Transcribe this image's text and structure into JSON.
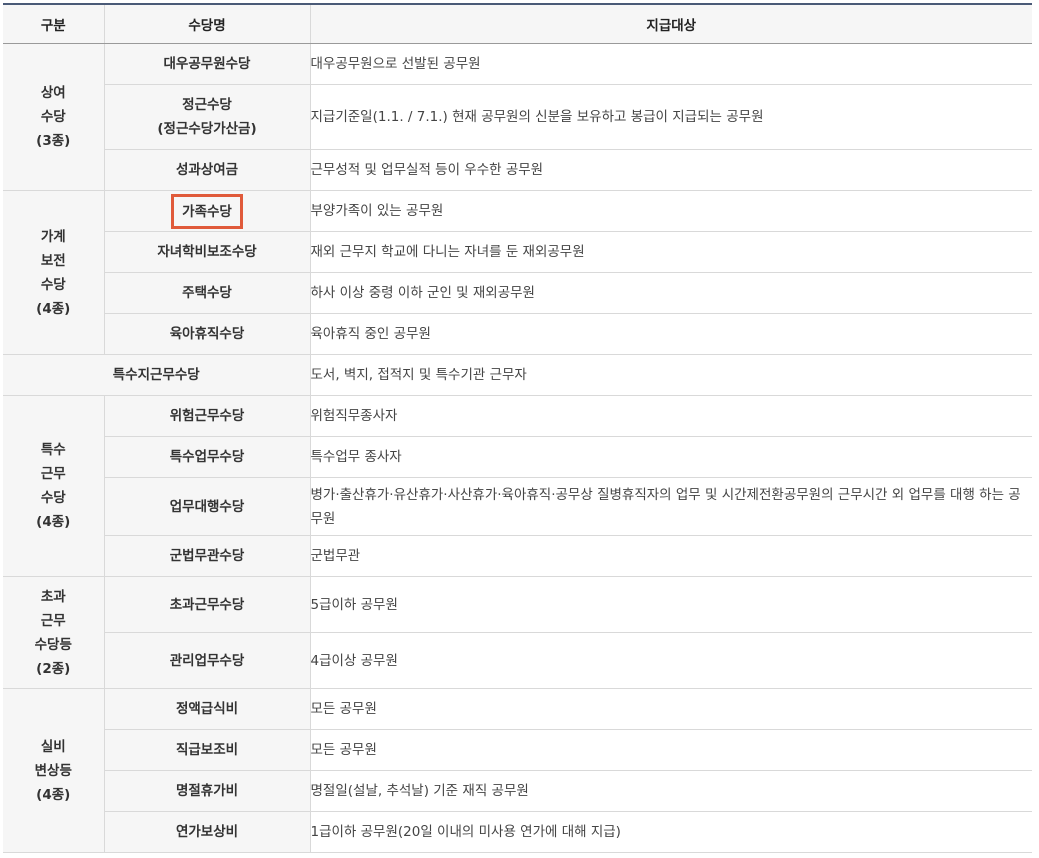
{
  "headers": {
    "category": "구분",
    "allowance": "수당명",
    "target": "지급대상"
  },
  "groups": [
    {
      "category": "상여\n수당\n(3종)",
      "rows": [
        {
          "name": "대우공무원수당",
          "target": "대우공무원으로 선발된 공무원"
        },
        {
          "name": "정근수당\n(정근수당가산금)",
          "target": "지급기준일(1.1. / 7.1.) 현재 공무원의 신분을 보유하고 봉급이 지급되는 공무원"
        },
        {
          "name": "성과상여금",
          "target": "근무성적 및 업무실적 등이 우수한 공무원"
        }
      ]
    },
    {
      "category": "가계\n보전\n수당\n(4종)",
      "rows": [
        {
          "name": "가족수당",
          "target": "부양가족이 있는 공무원",
          "highlighted": true
        },
        {
          "name": "자녀학비보조수당",
          "target": "재외 근무지 학교에 다니는 자녀를 둔 재외공무원"
        },
        {
          "name": "주택수당",
          "target": "하사 이상 중령 이하 군인 및 재외공무원"
        },
        {
          "name": "육아휴직수당",
          "target": "육아휴직 중인 공무원"
        }
      ]
    },
    {
      "single": {
        "name": "특수지근무수당",
        "target": "도서, 벽지, 접적지 및 특수기관 근무자"
      }
    },
    {
      "category": "특수\n근무\n수당\n(4종)",
      "rows": [
        {
          "name": "위험근무수당",
          "target": "위험직무종사자"
        },
        {
          "name": "특수업무수당",
          "target": "특수업무 종사자"
        },
        {
          "name": "업무대행수당",
          "target": "병가·출산휴가·유산휴가·사산휴가·육아휴직·공무상 질병휴직자의 업무 및 시간제전환공무원의 근무시간 외 업무를 대행 하는 공무원"
        },
        {
          "name": "군법무관수당",
          "target": "군법무관"
        }
      ]
    },
    {
      "category": "초과\n근무\n수당등\n(2종)",
      "rows": [
        {
          "name": "초과근무수당",
          "target": "5급이하 공무원"
        },
        {
          "name": "관리업무수당",
          "target": "4급이상 공무원"
        }
      ]
    },
    {
      "category": "실비\n변상등\n(4종)",
      "rows": [
        {
          "name": "정액급식비",
          "target": "모든 공무원"
        },
        {
          "name": "직급보조비",
          "target": "모든 공무원"
        },
        {
          "name": "명절휴가비",
          "target": "명절일(설날, 추석날) 기준 재직 공무원"
        },
        {
          "name": "연가보상비",
          "target": "1급이하 공무원(20일 이내의 미사용 연가에 대해 지급)"
        }
      ]
    }
  ],
  "highlight_color": "#e05a3a",
  "header_border_color": "#4a5a77"
}
